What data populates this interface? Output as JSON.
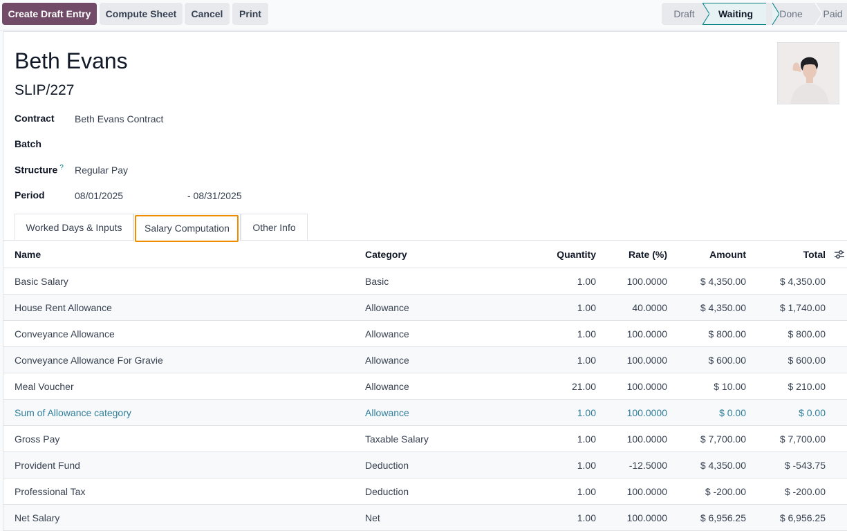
{
  "toolbar": {
    "create_draft_label": "Create Draft Entry",
    "compute_label": "Compute Sheet",
    "cancel_label": "Cancel",
    "print_label": "Print"
  },
  "statusbar": {
    "stages": [
      "Draft",
      "Waiting",
      "Done",
      "Paid"
    ],
    "active": "Waiting"
  },
  "employee": {
    "name": "Beth Evans",
    "slip_ref": "SLIP/227"
  },
  "fields": {
    "contract_label": "Contract",
    "contract_value": "Beth Evans Contract",
    "batch_label": "Batch",
    "batch_value": "",
    "structure_label": "Structure",
    "structure_help": "?",
    "structure_value": "Regular Pay",
    "period_label": "Period",
    "period_from": "08/01/2025",
    "period_to": "- 08/31/2025"
  },
  "tabs": [
    {
      "label": "Worked Days & Inputs"
    },
    {
      "label": "Salary Computation"
    },
    {
      "label": "Other Info"
    }
  ],
  "table": {
    "headers": {
      "name": "Name",
      "category": "Category",
      "quantity": "Quantity",
      "rate": "Rate (%)",
      "amount": "Amount",
      "total": "Total"
    },
    "rows": [
      {
        "name": "Basic Salary",
        "category": "Basic",
        "quantity": "1.00",
        "rate": "100.0000",
        "amount": "$ 4,350.00",
        "total": "$ 4,350.00"
      },
      {
        "name": "House Rent Allowance",
        "category": "Allowance",
        "quantity": "1.00",
        "rate": "40.0000",
        "amount": "$ 4,350.00",
        "total": "$ 1,740.00"
      },
      {
        "name": "Conveyance Allowance",
        "category": "Allowance",
        "quantity": "1.00",
        "rate": "100.0000",
        "amount": "$ 800.00",
        "total": "$ 800.00"
      },
      {
        "name": "Conveyance Allowance For Gravie",
        "category": "Allowance",
        "quantity": "1.00",
        "rate": "100.0000",
        "amount": "$ 600.00",
        "total": "$ 600.00"
      },
      {
        "name": "Meal Voucher",
        "category": "Allowance",
        "quantity": "21.00",
        "rate": "100.0000",
        "amount": "$ 10.00",
        "total": "$ 210.00"
      },
      {
        "name": "Sum of Allowance category",
        "category": "Allowance",
        "quantity": "1.00",
        "rate": "100.0000",
        "amount": "$ 0.00",
        "total": "$ 0.00"
      },
      {
        "name": "Gross Pay",
        "category": "Taxable Salary",
        "quantity": "1.00",
        "rate": "100.0000",
        "amount": "$ 7,700.00",
        "total": "$ 7,700.00"
      },
      {
        "name": "Provident Fund",
        "category": "Deduction",
        "quantity": "1.00",
        "rate": "-12.5000",
        "amount": "$ 4,350.00",
        "total": "$ -543.75"
      },
      {
        "name": "Professional Tax",
        "category": "Deduction",
        "quantity": "1.00",
        "rate": "100.0000",
        "amount": "$ -200.00",
        "total": "$ -200.00"
      },
      {
        "name": "Net Salary",
        "category": "Net",
        "quantity": "1.00",
        "rate": "100.0000",
        "amount": "$ 6,956.25",
        "total": "$ 6,956.25"
      }
    ]
  },
  "colors": {
    "primary": "#714b67",
    "active_stage": "#017e84",
    "link": "#2e7d9a",
    "focus": "#f08c00"
  }
}
